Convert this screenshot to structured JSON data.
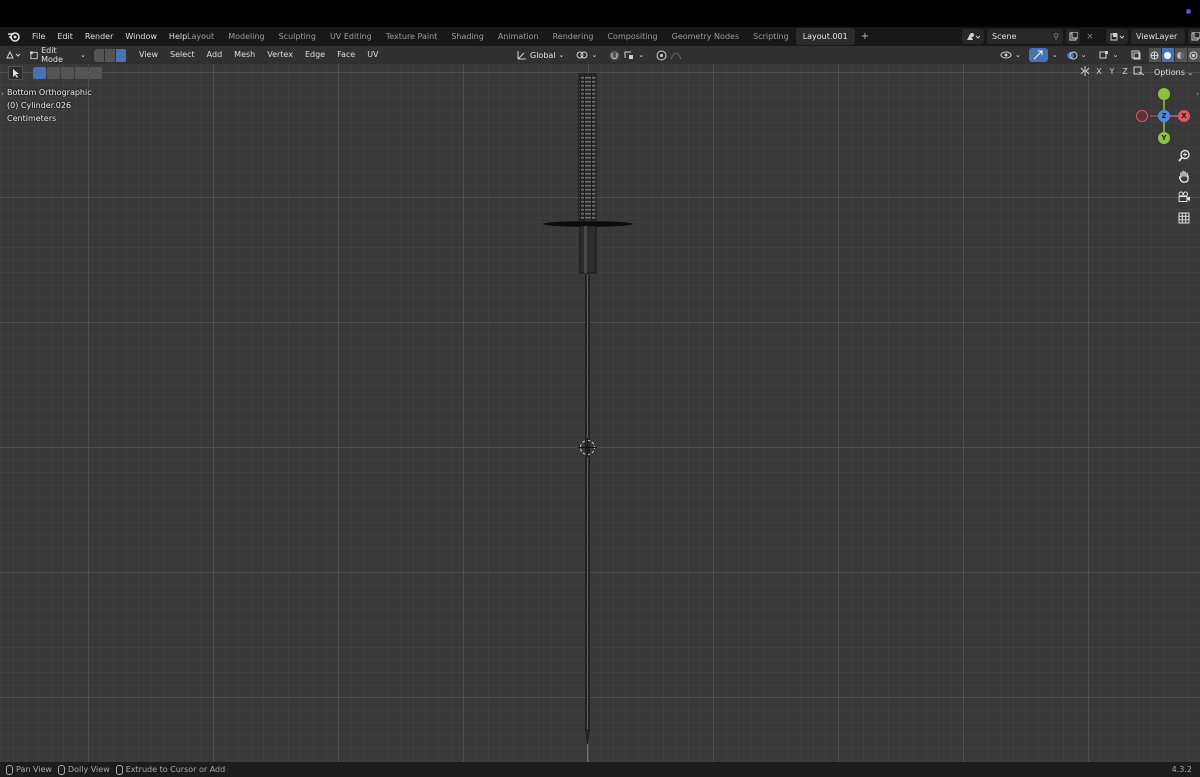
{
  "menubar": {
    "items": [
      "File",
      "Edit",
      "Render",
      "Window",
      "Help"
    ]
  },
  "workspaces": {
    "tabs": [
      "Layout",
      "Modeling",
      "Sculpting",
      "UV Editing",
      "Texture Paint",
      "Shading",
      "Animation",
      "Rendering",
      "Compositing",
      "Geometry Nodes",
      "Scripting",
      "Layout.001"
    ],
    "active": "Layout.001",
    "add": "+"
  },
  "scene": {
    "name": "Scene",
    "view_layer": "ViewLayer"
  },
  "header": {
    "mode": "Edit Mode",
    "menus": [
      "View",
      "Select",
      "Add",
      "Mesh",
      "Vertex",
      "Edge",
      "Face",
      "UV"
    ],
    "transform_orientation": "Global"
  },
  "viewport": {
    "view_name": "Bottom Orthographic",
    "object_name": "(0) Cylinder.026",
    "units": "Centimeters",
    "axis_labels": {
      "x": "X",
      "y": "Y",
      "z": "Z"
    },
    "options_label": "Options",
    "mirror_axes": [
      "X",
      "Y",
      "Z"
    ]
  },
  "statusbar": {
    "items": [
      "Pan View",
      "Dolly View",
      "Extrude to Cursor or Add"
    ],
    "version": "4.3.2"
  },
  "colors": {
    "accent": "#4772b3",
    "x_axis": "#e0565f",
    "y_axis": "#8bc341",
    "z_axis": "#4e8ee0"
  }
}
